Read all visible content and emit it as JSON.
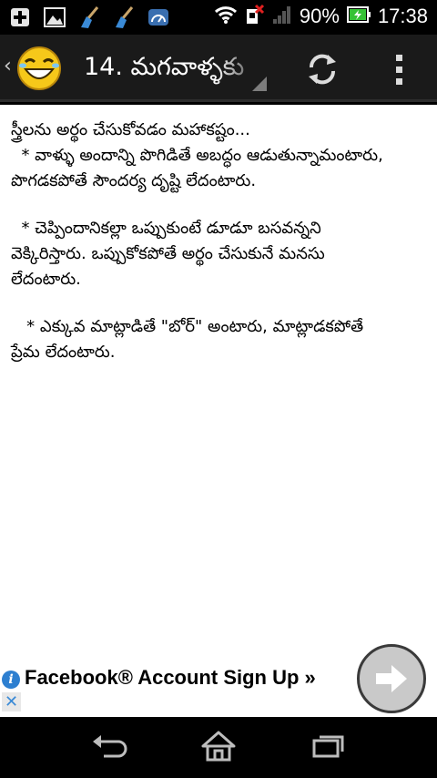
{
  "status_bar": {
    "battery_percent": "90%",
    "time": "17:38",
    "icons": [
      "add-box-icon",
      "image-icon",
      "broom-icon",
      "broom-icon",
      "speedometer-icon",
      "wifi-icon",
      "sim-no-signal-icon",
      "signal-icon",
      "battery-charging-icon"
    ]
  },
  "action_bar": {
    "title": "14. మగవాళ్ళకు",
    "logo_icon": "laughing-emoji-icon",
    "refresh_icon": "refresh-icon",
    "overflow_icon": "overflow-menu-icon"
  },
  "content": {
    "paragraphs": [
      "స్త్రీలను అర్థం చేసుకోవడం మహాకష్టం...\n  * వాళ్ళు అందాన్ని పొగిడితే అబద్ధం ఆడుతున్నామంటారు,\nపొగడకపోతే సౌందర్య దృష్టి లేదంటారు.",
      "  * చెప్పిందానికల్లా ఒప్పుకుంటే డూడూ బసవన్నని\nవెక్కిరిస్తారు. ఒప్పుకోకపోతే అర్థం చేసుకునే మనసు\nలేదంటారు.",
      "   * ఎక్కువ మాట్లాడితే \"బోర్\" అంటారు, మాట్లాడకపోతే\nప్రేమ లేదంటారు."
    ]
  },
  "ad": {
    "text": "Facebook® Account Sign Up »",
    "info_icon": "i",
    "close_icon": "✕"
  },
  "nav_bar": {
    "icons": [
      "back-icon",
      "home-icon",
      "recent-apps-icon"
    ]
  },
  "colors": {
    "action_bar_bg": "#1a1a1a",
    "content_bg": "#ffffff",
    "ad_info_blue": "#2d7fd0"
  }
}
